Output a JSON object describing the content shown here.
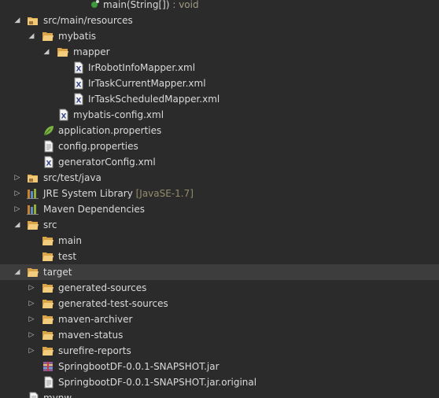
{
  "tree": {
    "method_row": {
      "label": "main(String[])",
      "type": " : void"
    },
    "items": [
      {
        "key": "src_main_resources",
        "label": "src/main/resources",
        "expanded": true
      },
      {
        "key": "mybatis",
        "label": "mybatis",
        "expanded": true
      },
      {
        "key": "mapper",
        "label": "mapper",
        "expanded": true
      },
      {
        "key": "file1",
        "label": "IrRobotInfoMapper.xml"
      },
      {
        "key": "file2",
        "label": "IrTaskCurrentMapper.xml"
      },
      {
        "key": "file3",
        "label": "IrTaskScheduledMapper.xml"
      },
      {
        "key": "file4",
        "label": "mybatis-config.xml"
      },
      {
        "key": "file5",
        "label": "application.properties"
      },
      {
        "key": "file6",
        "label": "config.properties"
      },
      {
        "key": "file7",
        "label": "generatorConfig.xml"
      },
      {
        "key": "src_test_java",
        "label": "src/test/java",
        "expanded": false
      },
      {
        "key": "jre",
        "label": "JRE System Library",
        "decoration": " [JavaSE-1.7]",
        "expanded": false
      },
      {
        "key": "maven_deps",
        "label": "Maven Dependencies",
        "expanded": false
      },
      {
        "key": "src",
        "label": "src",
        "expanded": true
      },
      {
        "key": "main",
        "label": "main"
      },
      {
        "key": "test",
        "label": "test"
      },
      {
        "key": "target",
        "label": "target",
        "expanded": true,
        "selected": true
      },
      {
        "key": "gen_sources",
        "label": "generated-sources",
        "expanded": false
      },
      {
        "key": "gen_test_sources",
        "label": "generated-test-sources",
        "expanded": false
      },
      {
        "key": "maven_archiver",
        "label": "maven-archiver",
        "expanded": false
      },
      {
        "key": "maven_status",
        "label": "maven-status",
        "expanded": false
      },
      {
        "key": "surefire",
        "label": "surefire-reports",
        "expanded": false
      },
      {
        "key": "jar",
        "label": "SpringbootDF-0.0.1-SNAPSHOT.jar"
      },
      {
        "key": "jar_original",
        "label": "SpringbootDF-0.0.1-SNAPSHOT.jar.original"
      },
      {
        "key": "mvnw",
        "label": "mvnw"
      }
    ]
  },
  "colors": {
    "background": "#2b2b2b",
    "selected_row": "#3d3d3d",
    "text": "#dadada",
    "decoration": "#948d6c"
  }
}
